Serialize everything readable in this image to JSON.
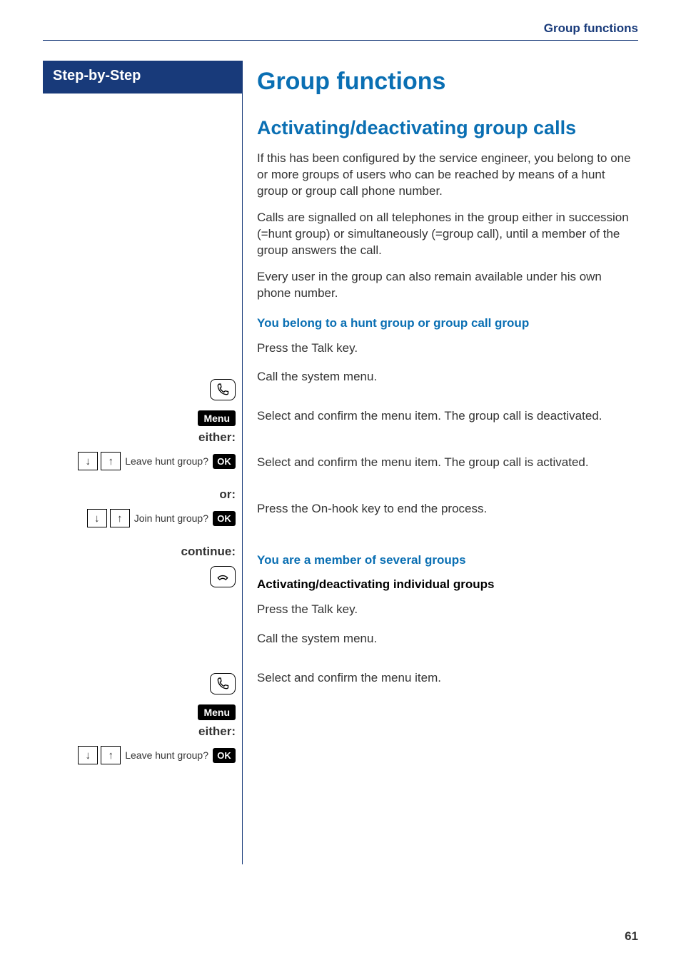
{
  "header": "Group functions",
  "sidebar": {
    "title": "Step-by-Step"
  },
  "main": {
    "title": "Group functions",
    "section": "Activating/deactivating group calls",
    "p1": "If this has been configured by the service engineer, you belong to one or more groups of users who can be reached by means of a hunt group or group call phone number.",
    "p2": "Calls are signalled on all telephones in the group either in succession (=hunt group) or simultaneously (=group call), until a member of the group answers the call.",
    "p3": "Every user in the group can also remain available under his own phone number.",
    "sub1": "You belong to a hunt group or group call group",
    "talk1": "Press the Talk key.",
    "menu1": "Call the system menu.",
    "either": "either:",
    "leave_label": "Leave hunt group?",
    "leave_text": "Select and confirm the menu item. The group call is deactivated.",
    "or": "or:",
    "join_label": "Join hunt group?",
    "join_text": "Select and confirm the menu item. The group call is activated.",
    "continue": "continue:",
    "onhook": "Press the On-hook key to end the process.",
    "sub2": "You are a member of several groups",
    "sub2b": "Activating/deactivating individual groups",
    "talk2": "Press the Talk key.",
    "menu2": "Call the system menu.",
    "either2": "either:",
    "leave2_label": "Leave hunt group?",
    "leave2_text": "Select and confirm the menu item.",
    "menu_badge": "Menu",
    "ok_badge": "OK"
  },
  "page_number": "61"
}
